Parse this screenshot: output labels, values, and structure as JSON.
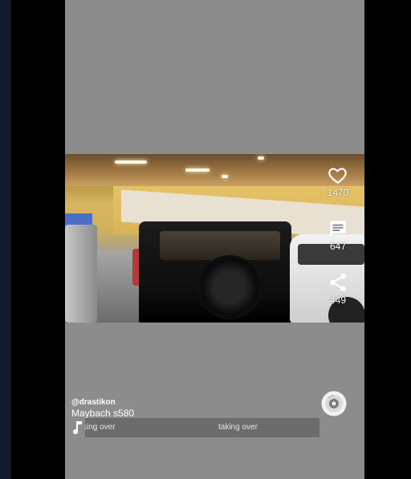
{
  "video": {
    "author": "@drastikon",
    "caption": "Maybach s580"
  },
  "actions": {
    "likes": "1470",
    "comments": "647",
    "shares": "449"
  },
  "music": {
    "track_text_1": "king over",
    "track_text_2": "taking over"
  },
  "icons": {
    "like": "heart-icon",
    "comment": "comment-icon",
    "share": "share-icon",
    "music": "music-note-icon",
    "disc": "music-disc-icon"
  },
  "colors": {
    "background": "#000000",
    "player_bg": "#8c8c8c",
    "text": "#ffffff",
    "music_bar": "#6c6c6c"
  }
}
